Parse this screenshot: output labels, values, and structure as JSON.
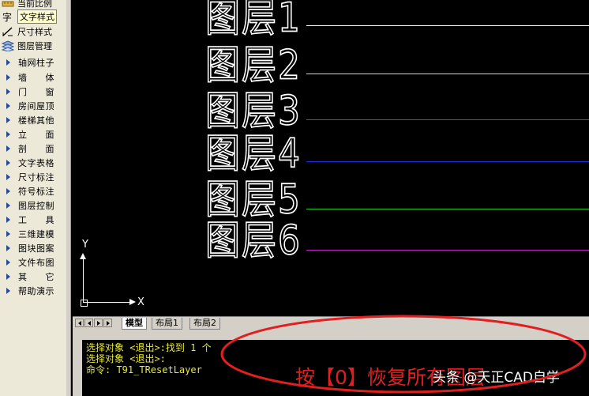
{
  "palette": {
    "top_items": [
      {
        "label": "当前比例",
        "icon": "scale-icon"
      },
      {
        "label": "文字样式",
        "icon": "text-style-icon",
        "selected": true
      },
      {
        "label": "尺寸样式",
        "icon": "dimension-style-icon"
      },
      {
        "label": "图层管理",
        "icon": "layers-icon"
      }
    ],
    "menu_items": [
      {
        "label": "轴网柱子"
      },
      {
        "label": "墙　　体"
      },
      {
        "label": "门　　窗"
      },
      {
        "label": "房间屋顶"
      },
      {
        "label": "楼梯其他"
      },
      {
        "label": "立　　面"
      },
      {
        "label": "剖　　面"
      },
      {
        "label": "文字表格"
      },
      {
        "label": "尺寸标注"
      },
      {
        "label": "符号标注"
      },
      {
        "label": "图层控制"
      },
      {
        "label": "工　　具"
      },
      {
        "label": "三维建模"
      },
      {
        "label": "图块图案"
      },
      {
        "label": "文件布图"
      },
      {
        "label": "其　　它"
      },
      {
        "label": "帮助演示"
      }
    ]
  },
  "canvas": {
    "layers": [
      {
        "label": "图层1",
        "color": "#ffffff"
      },
      {
        "label": "图层2",
        "color": "#e8e840"
      },
      {
        "label": "图层3",
        "color": "#e02020"
      },
      {
        "label": "图层4",
        "color": "#2030e0"
      },
      {
        "label": "图层5",
        "color": "#20c020"
      },
      {
        "label": "图层6",
        "color": "#c020c0"
      }
    ],
    "ucs": {
      "x_label": "X",
      "y_label": "Y"
    }
  },
  "tabs": [
    {
      "label": "模型",
      "active": true
    },
    {
      "label": "布局1",
      "active": false
    },
    {
      "label": "布局2",
      "active": false
    }
  ],
  "command": {
    "lines": [
      "选择对象 <退出>:找到 1 个",
      "选择对象 <退出>:",
      "命令: T91_TResetLayer"
    ]
  },
  "annotation": {
    "text": "按【0】恢复所有图层",
    "color": "#e02020"
  },
  "watermark": "头条 @天正CAD自学"
}
